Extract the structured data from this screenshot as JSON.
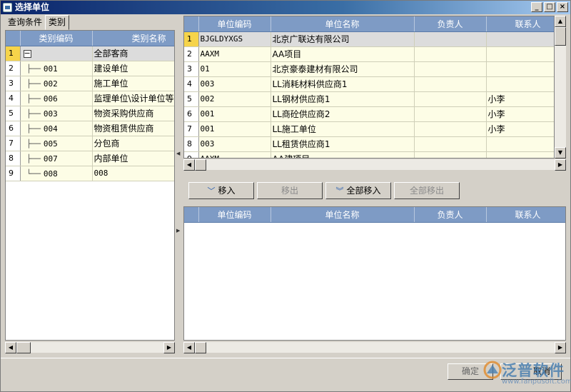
{
  "window": {
    "title": "选择单位",
    "min": "_",
    "max": "□",
    "close": "×"
  },
  "tabs": [
    {
      "label": "查询条件"
    },
    {
      "label": "类别"
    }
  ],
  "category_grid": {
    "columns": [
      "类别编码",
      "类别名称"
    ],
    "rows": [
      {
        "num": "1",
        "code": "",
        "name": "全部客商"
      },
      {
        "num": "2",
        "code": "001",
        "name": "建设单位"
      },
      {
        "num": "3",
        "code": "002",
        "name": "施工单位"
      },
      {
        "num": "4",
        "code": "006",
        "name": "监理单位\\设计单位等"
      },
      {
        "num": "5",
        "code": "003",
        "name": "物资采购供应商"
      },
      {
        "num": "6",
        "code": "004",
        "name": "物资租赁供应商"
      },
      {
        "num": "7",
        "code": "005",
        "name": "分包商"
      },
      {
        "num": "8",
        "code": "007",
        "name": "内部单位"
      },
      {
        "num": "9",
        "code": "008",
        "name": "008"
      }
    ]
  },
  "unit_grid": {
    "columns": [
      "单位编码",
      "单位名称",
      "负责人",
      "联系人"
    ],
    "rows": [
      {
        "num": "1",
        "code": "BJGLDYXGS",
        "name": "北京广联达有限公司",
        "owner": "",
        "contact": ""
      },
      {
        "num": "2",
        "code": "AAXM",
        "name": "AA项目",
        "owner": "",
        "contact": ""
      },
      {
        "num": "3",
        "code": "01",
        "name": "北京豪泰建材有限公司",
        "owner": "",
        "contact": ""
      },
      {
        "num": "4",
        "code": "003",
        "name": "LL消耗材料供应商1",
        "owner": "",
        "contact": ""
      },
      {
        "num": "5",
        "code": "002",
        "name": "LL钢材供应商1",
        "owner": "",
        "contact": "小李"
      },
      {
        "num": "6",
        "code": "001",
        "name": "LL商砼供应商2",
        "owner": "",
        "contact": "小李"
      },
      {
        "num": "7",
        "code": "001",
        "name": "LL施工单位",
        "owner": "",
        "contact": "小李"
      },
      {
        "num": "8",
        "code": "003",
        "name": "LL租赁供应商1",
        "owner": "",
        "contact": ""
      },
      {
        "num": "9",
        "code": "AAXM",
        "name": "AA建项目",
        "owner": "",
        "contact": ""
      }
    ]
  },
  "buttons": {
    "move_in": "移入",
    "move_out": "移出",
    "move_all_in": "全部移入",
    "move_all_out": "全部移出",
    "ok": "确定",
    "cancel": "取消"
  },
  "selected_grid": {
    "columns": [
      "单位编码",
      "单位名称",
      "负责人",
      "联系人"
    ]
  },
  "logo": {
    "text": "泛普软件",
    "url": "www.fanpusoft.com"
  },
  "colors": {
    "header": "#7e9bc5",
    "row_bg": "#fdfde6",
    "selected_marker": "#f6d44a"
  }
}
